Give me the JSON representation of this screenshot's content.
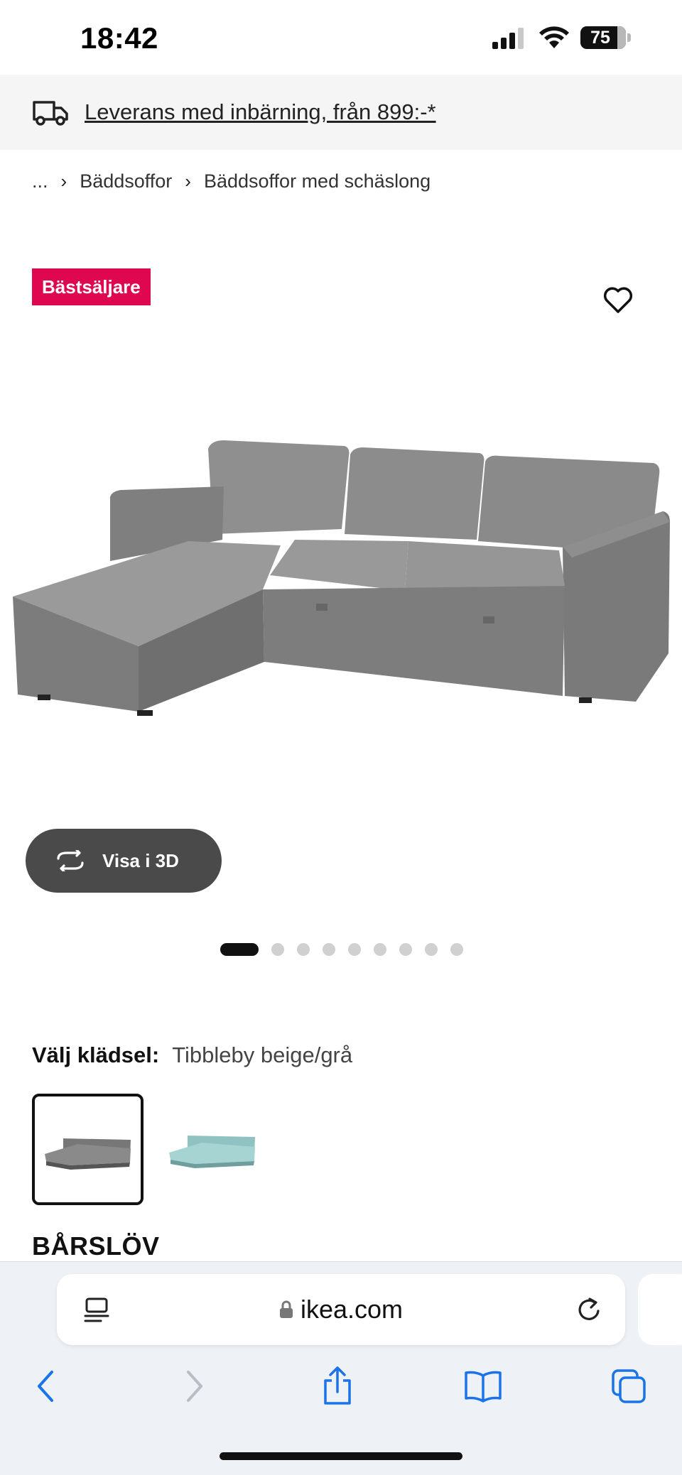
{
  "status_bar": {
    "time": "18:42",
    "battery": "75",
    "icons": [
      "signal-icon",
      "wifi-icon",
      "battery-icon"
    ]
  },
  "delivery_banner": {
    "icon": "truck-icon",
    "text": "Leverans med inbärning, från 899:-*"
  },
  "breadcrumb": {
    "items": [
      "...",
      "Bäddsoffor",
      "Bäddsoffor med schäslong"
    ],
    "separator_icon": "chevron-right-icon"
  },
  "product_image": {
    "badge": "Bästsäljare",
    "badge_color": "#e00751",
    "favorite_icon": "heart-icon",
    "view_3d_label": "Visa i 3D",
    "view_3d_icon": "rotate-3d-icon",
    "carousel_total": 9,
    "carousel_active_index": 0
  },
  "options": {
    "cover_label": "Välj klädsel:",
    "cover_value": "Tibbleby beige/grå",
    "swatches": [
      {
        "name": "grey",
        "color": "#8a8a8a",
        "selected": true
      },
      {
        "name": "light-turquoise",
        "color": "#9ccfcd",
        "selected": false
      }
    ]
  },
  "product": {
    "name": "BÅRSLÖV"
  },
  "browser": {
    "url": "ikea.com",
    "toolbar_icons": [
      "back-icon",
      "forward-icon",
      "share-icon",
      "bookmarks-icon",
      "tabs-icon"
    ],
    "accent": "#1a73e8"
  }
}
